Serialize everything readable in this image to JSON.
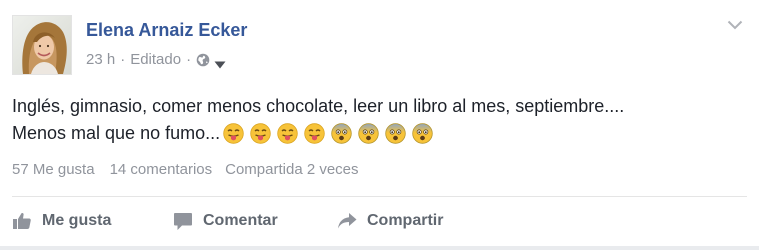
{
  "post": {
    "author": "Elena Arnaiz Ecker",
    "time": "23 h",
    "separator": "·",
    "edited": "Editado",
    "privacy_icon": "globe-icon",
    "menu_icon": "chevron-down-icon",
    "text_line1": "Inglés, gimnasio, comer menos chocolate, leer un libro al mes, septiembre....",
    "text_line2": "Menos mal que no fumo...",
    "emojis": [
      "tongue-out-emoji",
      "tongue-out-emoji",
      "tongue-out-emoji",
      "tongue-out-emoji",
      "anguished-emoji",
      "anguished-emoji",
      "anguished-emoji",
      "anguished-emoji"
    ]
  },
  "stats": {
    "likes": "57 Me gusta",
    "comments": "14 comentarios",
    "shares": "Compartida 2 veces"
  },
  "actions": {
    "like": "Me gusta",
    "comment": "Comentar",
    "share": "Compartir"
  },
  "colors": {
    "author_link": "#365899",
    "meta_text": "#90949c",
    "action_text": "#606770",
    "body_text": "#1d2129"
  }
}
